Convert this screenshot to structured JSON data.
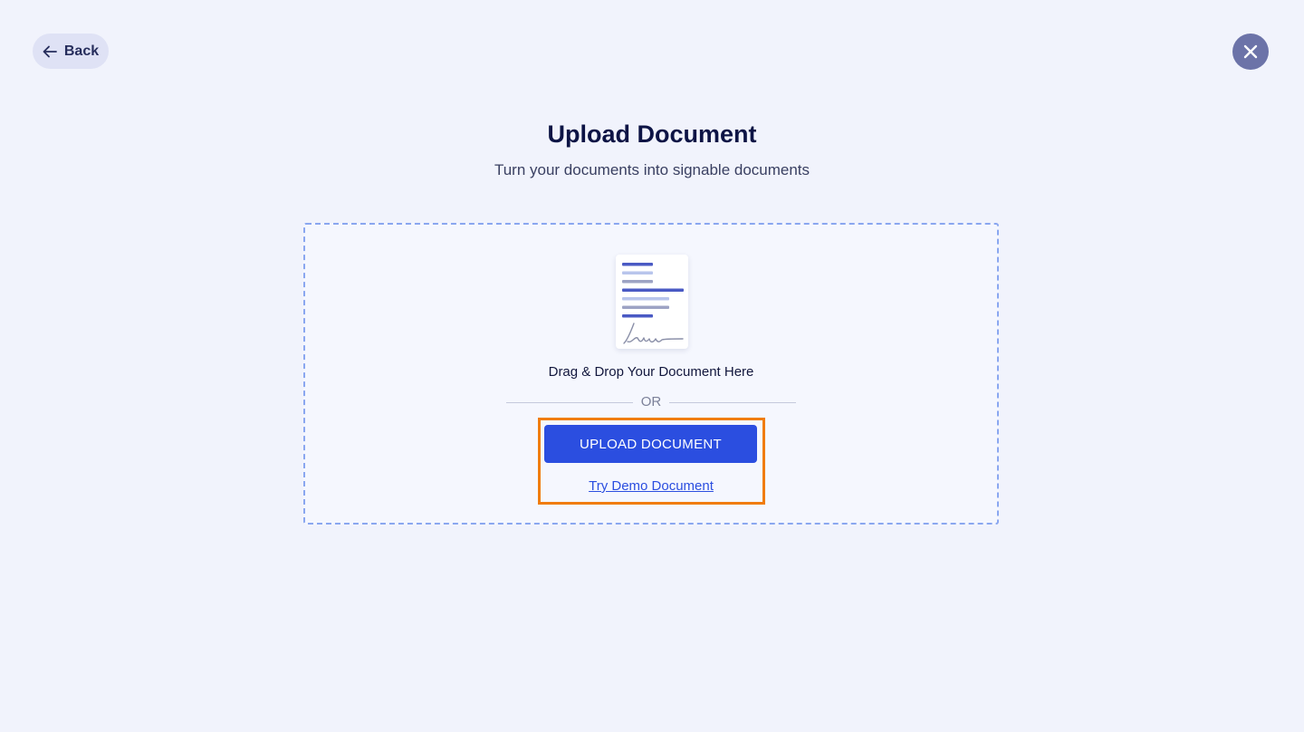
{
  "header": {
    "back_label": "Back",
    "back_icon": "arrow-left-icon",
    "close_icon": "close-icon"
  },
  "main": {
    "title": "Upload Document",
    "subtitle": "Turn your documents into signable documents"
  },
  "dropzone": {
    "icon": "document-signature-icon",
    "drop_text": "Drag & Drop Your Document Here",
    "or_text": "OR",
    "upload_button_label": "UPLOAD DOCUMENT",
    "demo_link_label": "Try Demo Document"
  },
  "colors": {
    "background": "#f1f3fc",
    "accent": "#2b4ee0",
    "highlight": "#f07d0f",
    "close_button": "#6c73a8",
    "title": "#0d1445"
  }
}
